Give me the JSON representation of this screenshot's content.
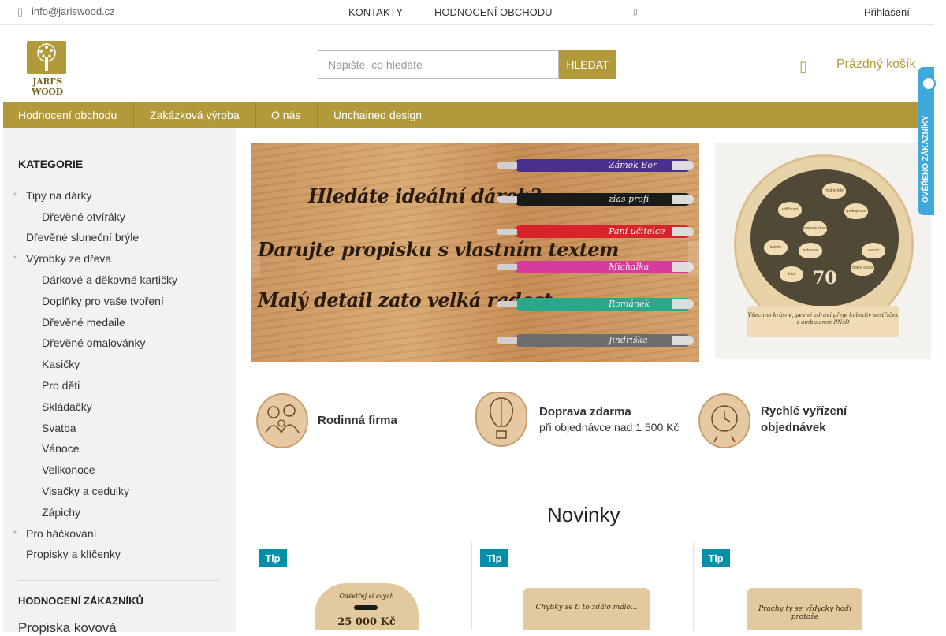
{
  "topbar": {
    "email": "info@jariswood.cz",
    "contacts": "KONTAKTY",
    "shop_rating": "HODNOCENÍ OBCHODU",
    "login": "Přihlášení"
  },
  "header": {
    "logo_text": "JARI'S WOOD",
    "search_placeholder": "Napište, co hledáte",
    "search_button": "HLEDAT",
    "cart_label": "Prázdný košík"
  },
  "nav": {
    "items": [
      {
        "label": "Hodnocení obchodu"
      },
      {
        "label": "Zakázková výroba"
      },
      {
        "label": "O nás"
      },
      {
        "label": "Unchained design"
      }
    ]
  },
  "sidebar": {
    "heading": "KATEGORIE",
    "categories": [
      {
        "label": "Tipy na dárky"
      },
      {
        "label": "Dřevěné otvíráky"
      },
      {
        "label": "Dřevěné sluneční brýle"
      },
      {
        "label": "Výrobky ze dřeva"
      },
      {
        "label": "Dárkové a děkovné kartičky"
      },
      {
        "label": "Doplňky pro vaše tvoření"
      },
      {
        "label": "Dřevěné medaile"
      },
      {
        "label": "Dřevěné omalovánky"
      },
      {
        "label": "Kasičky"
      },
      {
        "label": "Pro děti"
      },
      {
        "label": "Skládačky"
      },
      {
        "label": "Svatba"
      },
      {
        "label": "Vánoce"
      },
      {
        "label": "Velikonoce"
      },
      {
        "label": "Visačky a cedulky"
      },
      {
        "label": "Zápichy"
      },
      {
        "label": "Pro háčkování"
      },
      {
        "label": "Propisky a klíčenky"
      }
    ],
    "reviews_heading": "HODNOCENÍ ZÁKAZNÍKŮ",
    "review_title": "Propiska kovová"
  },
  "banner": {
    "lines": [
      "Hledáte ideální dárek?",
      "Darujte propisku s vlastním textem",
      "Malý detail zato velká radost"
    ],
    "pens": [
      {
        "text": "Zámek Bor",
        "color": "#4b2f8f"
      },
      {
        "text": "zias profi",
        "color": "#1a1a1a"
      },
      {
        "text": "Paní učitelce",
        "color": "#d8232a"
      },
      {
        "text": "Michalka",
        "color": "#d83a9e"
      },
      {
        "text": "Románek",
        "color": "#2aa98a"
      },
      {
        "text": "Jindriška",
        "color": "#6d6d6d"
      }
    ]
  },
  "side_banner": {
    "hearts": [
      "Hodné lidé",
      "vděčnost",
      "spokojenost",
      "laskavé slovo",
      "úsměv",
      "laskavost",
      "radost",
      "dobré slovo",
      "klid"
    ],
    "age": "70",
    "plaque": "Všechno krásné, pevné zdraví přeje kolektiv sestřiček z ambulance PNsD"
  },
  "badge": {
    "text": "OVĚŘENO ZÁKAZNÍKY"
  },
  "features": [
    {
      "title": "Rodinná firma",
      "subtitle": ""
    },
    {
      "title": "Doprava zdarma",
      "subtitle": "při objednávce nad 1 500 Kč"
    },
    {
      "title": "Rychlé vyřízení",
      "subtitle": "objednávek"
    }
  ],
  "novinky": {
    "heading": "Novinky",
    "products": [
      {
        "badge": "Tip",
        "image_text": "Odšetřej si svých",
        "price_text": "25 000 Kč"
      },
      {
        "badge": "Tip",
        "image_text": "Chybky se ti to zdálo málo...",
        "price_text": ""
      },
      {
        "badge": "Tip",
        "image_text": "Prachy ty se vždycky hodí protože",
        "price_text": ""
      }
    ]
  },
  "colors": {
    "brand": "#b29a3b",
    "tip": "#008fa8",
    "badge": "#3fa9dc",
    "sidebar_bg": "#f2f2f2"
  }
}
